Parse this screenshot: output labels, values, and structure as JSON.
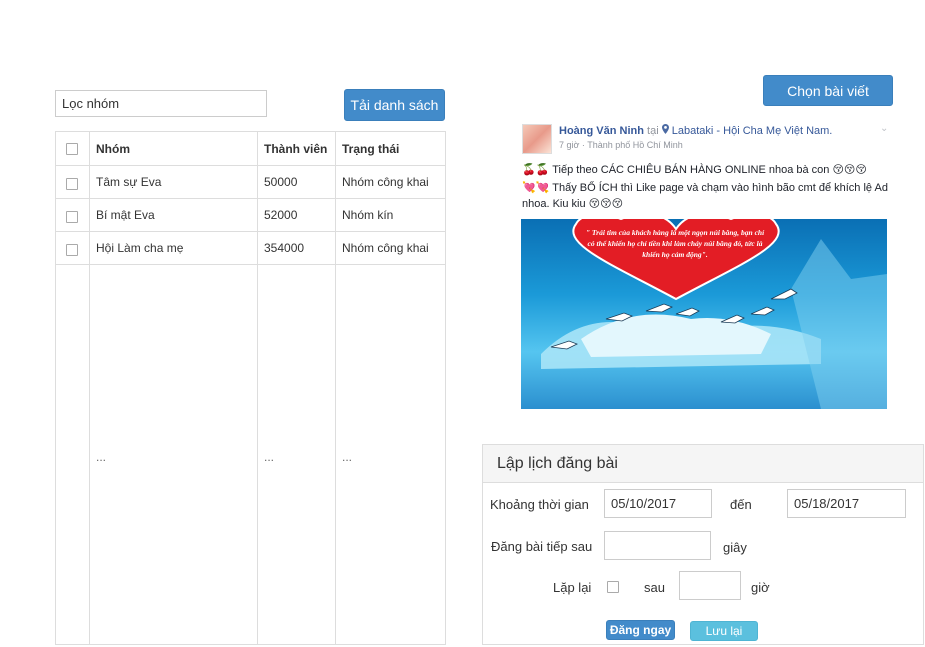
{
  "filter": {
    "placeholder": "Lọc nhóm"
  },
  "load_button_label": "Tải danh sách",
  "table": {
    "headers": {
      "group": "Nhóm",
      "members": "Thành viên",
      "status": "Trạng thái"
    },
    "rows": [
      {
        "group": "Tâm sự Eva",
        "members": "50000",
        "status": "Nhóm công khai"
      },
      {
        "group": "Bí mật Eva",
        "members": "52000",
        "status": "Nhóm kín"
      },
      {
        "group": "Hội Làm cha mẹ",
        "members": "354000",
        "status": "Nhóm công khai"
      }
    ],
    "ellipsis": "..."
  },
  "choose_post_label": "Chọn bài viết",
  "post": {
    "author": "Hoàng Văn Ninh",
    "at_word": "tại",
    "location": "Labataki - Hội Cha Mẹ Việt Nam.",
    "meta": "7 giờ · Thành phố Hồ Chí Minh",
    "line1": "🍒🍒 Tiếp theo CÁC CHIÊU BÁN HÀNG ONLINE nhoa bà con 😚😚😚",
    "line2": "💘💘 Thấy BỔ ÍCH thì Like page và chạm vào hình bão cmt để khích lệ Ad",
    "line3": "nhoa. Kiu kiu 😚😚😚",
    "image_quote": "\" Trái tim của khách hàng là một ngọn núi băng, bạn chỉ có thể khiến họ chỉ tiền khi làm cháy núi băng đó, tức là khiến họ cảm động\"."
  },
  "schedule": {
    "title": "Lập lịch đăng bài",
    "period_label": "Khoảng thời gian",
    "start_date": "05/10/2017",
    "to_label": "đến",
    "end_date": "05/18/2017",
    "next_post_label": "Đăng bài tiếp sau",
    "seconds_label": "giây",
    "repeat_label": "Lặp lại",
    "after_label": "sau",
    "hours_label": "giờ",
    "post_now_label": "Đăng ngay",
    "save_label": "Lưu lại"
  },
  "colors": {
    "primary": "#428bca",
    "save": "#5bc0de"
  }
}
